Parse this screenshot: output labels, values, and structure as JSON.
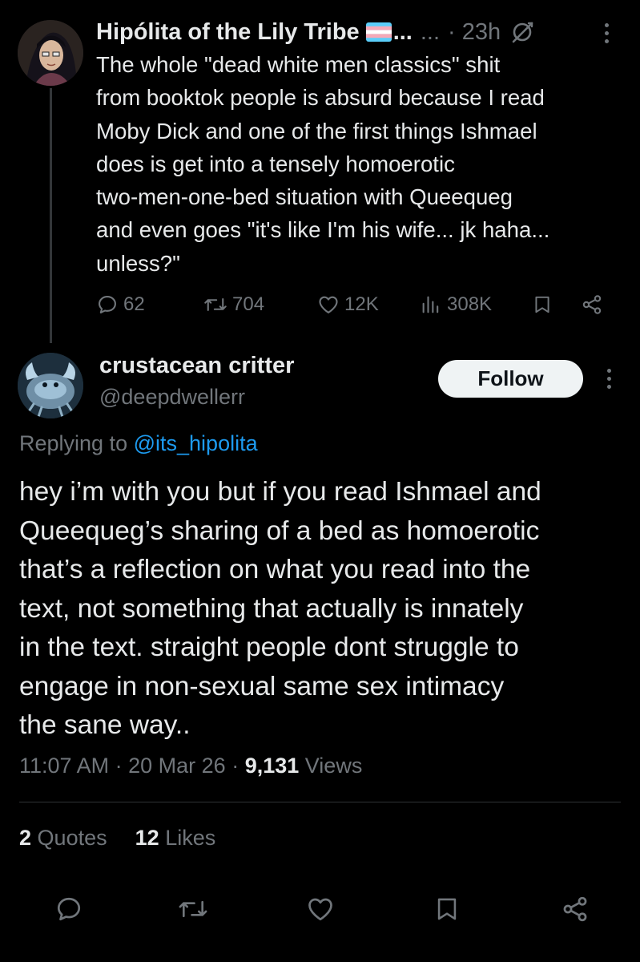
{
  "parent_tweet": {
    "display_name": "Hipólita of the Lily Tribe",
    "name_ellipsis": "...",
    "handle": "...",
    "time": "· 23h",
    "text_lines": [
      "The whole \"dead white men classics\" shit",
      "from booktok people is absurd  because I read",
      "Moby Dick and one of the first things Ishmael",
      "does is get into a tensely homoerotic",
      "two-men-one-bed situation with Queequeg",
      "and even goes \"it's like I'm his wife... jk haha...",
      "unless?\""
    ],
    "replies": "62",
    "reposts": "704",
    "likes": "12K",
    "views": "308K"
  },
  "reply": {
    "display_name": "crustacean critter",
    "handle": "@deepdwellerr",
    "follow_label": "Follow",
    "replying_prefix": "Replying to",
    "replying_to": "@its_hipolita",
    "text_lines": [
      "hey i’m with you but if you read Ishmael and",
      "Queequeg’s sharing of a bed as homoerotic",
      "that’s a reflection on what you read into the",
      "text, not something that actually is innately",
      "in the text. straight people dont struggle to",
      "engage in non-sexual same sex intimacy",
      "the sane way.."
    ],
    "time": "11:07 AM",
    "date": "20 Mar 26",
    "views_count": "9,131",
    "views_label": "Views",
    "quotes_count": "2",
    "quotes_label": "Quotes",
    "likes_count": "12",
    "likes_label": "Likes"
  },
  "icons": {
    "reply": "reply-icon",
    "repost": "repost-icon",
    "like": "heart-icon",
    "views": "views-icon",
    "bookmark": "bookmark-icon",
    "share": "share-icon",
    "more": "more-icon",
    "grok": "grok-icon",
    "flag": "trans-flag-icon"
  },
  "colors": {
    "background": "#000000",
    "text": "#e7e9ea",
    "muted": "#71767b",
    "link": "#1d9bf0",
    "follow_bg": "#eff3f4"
  }
}
